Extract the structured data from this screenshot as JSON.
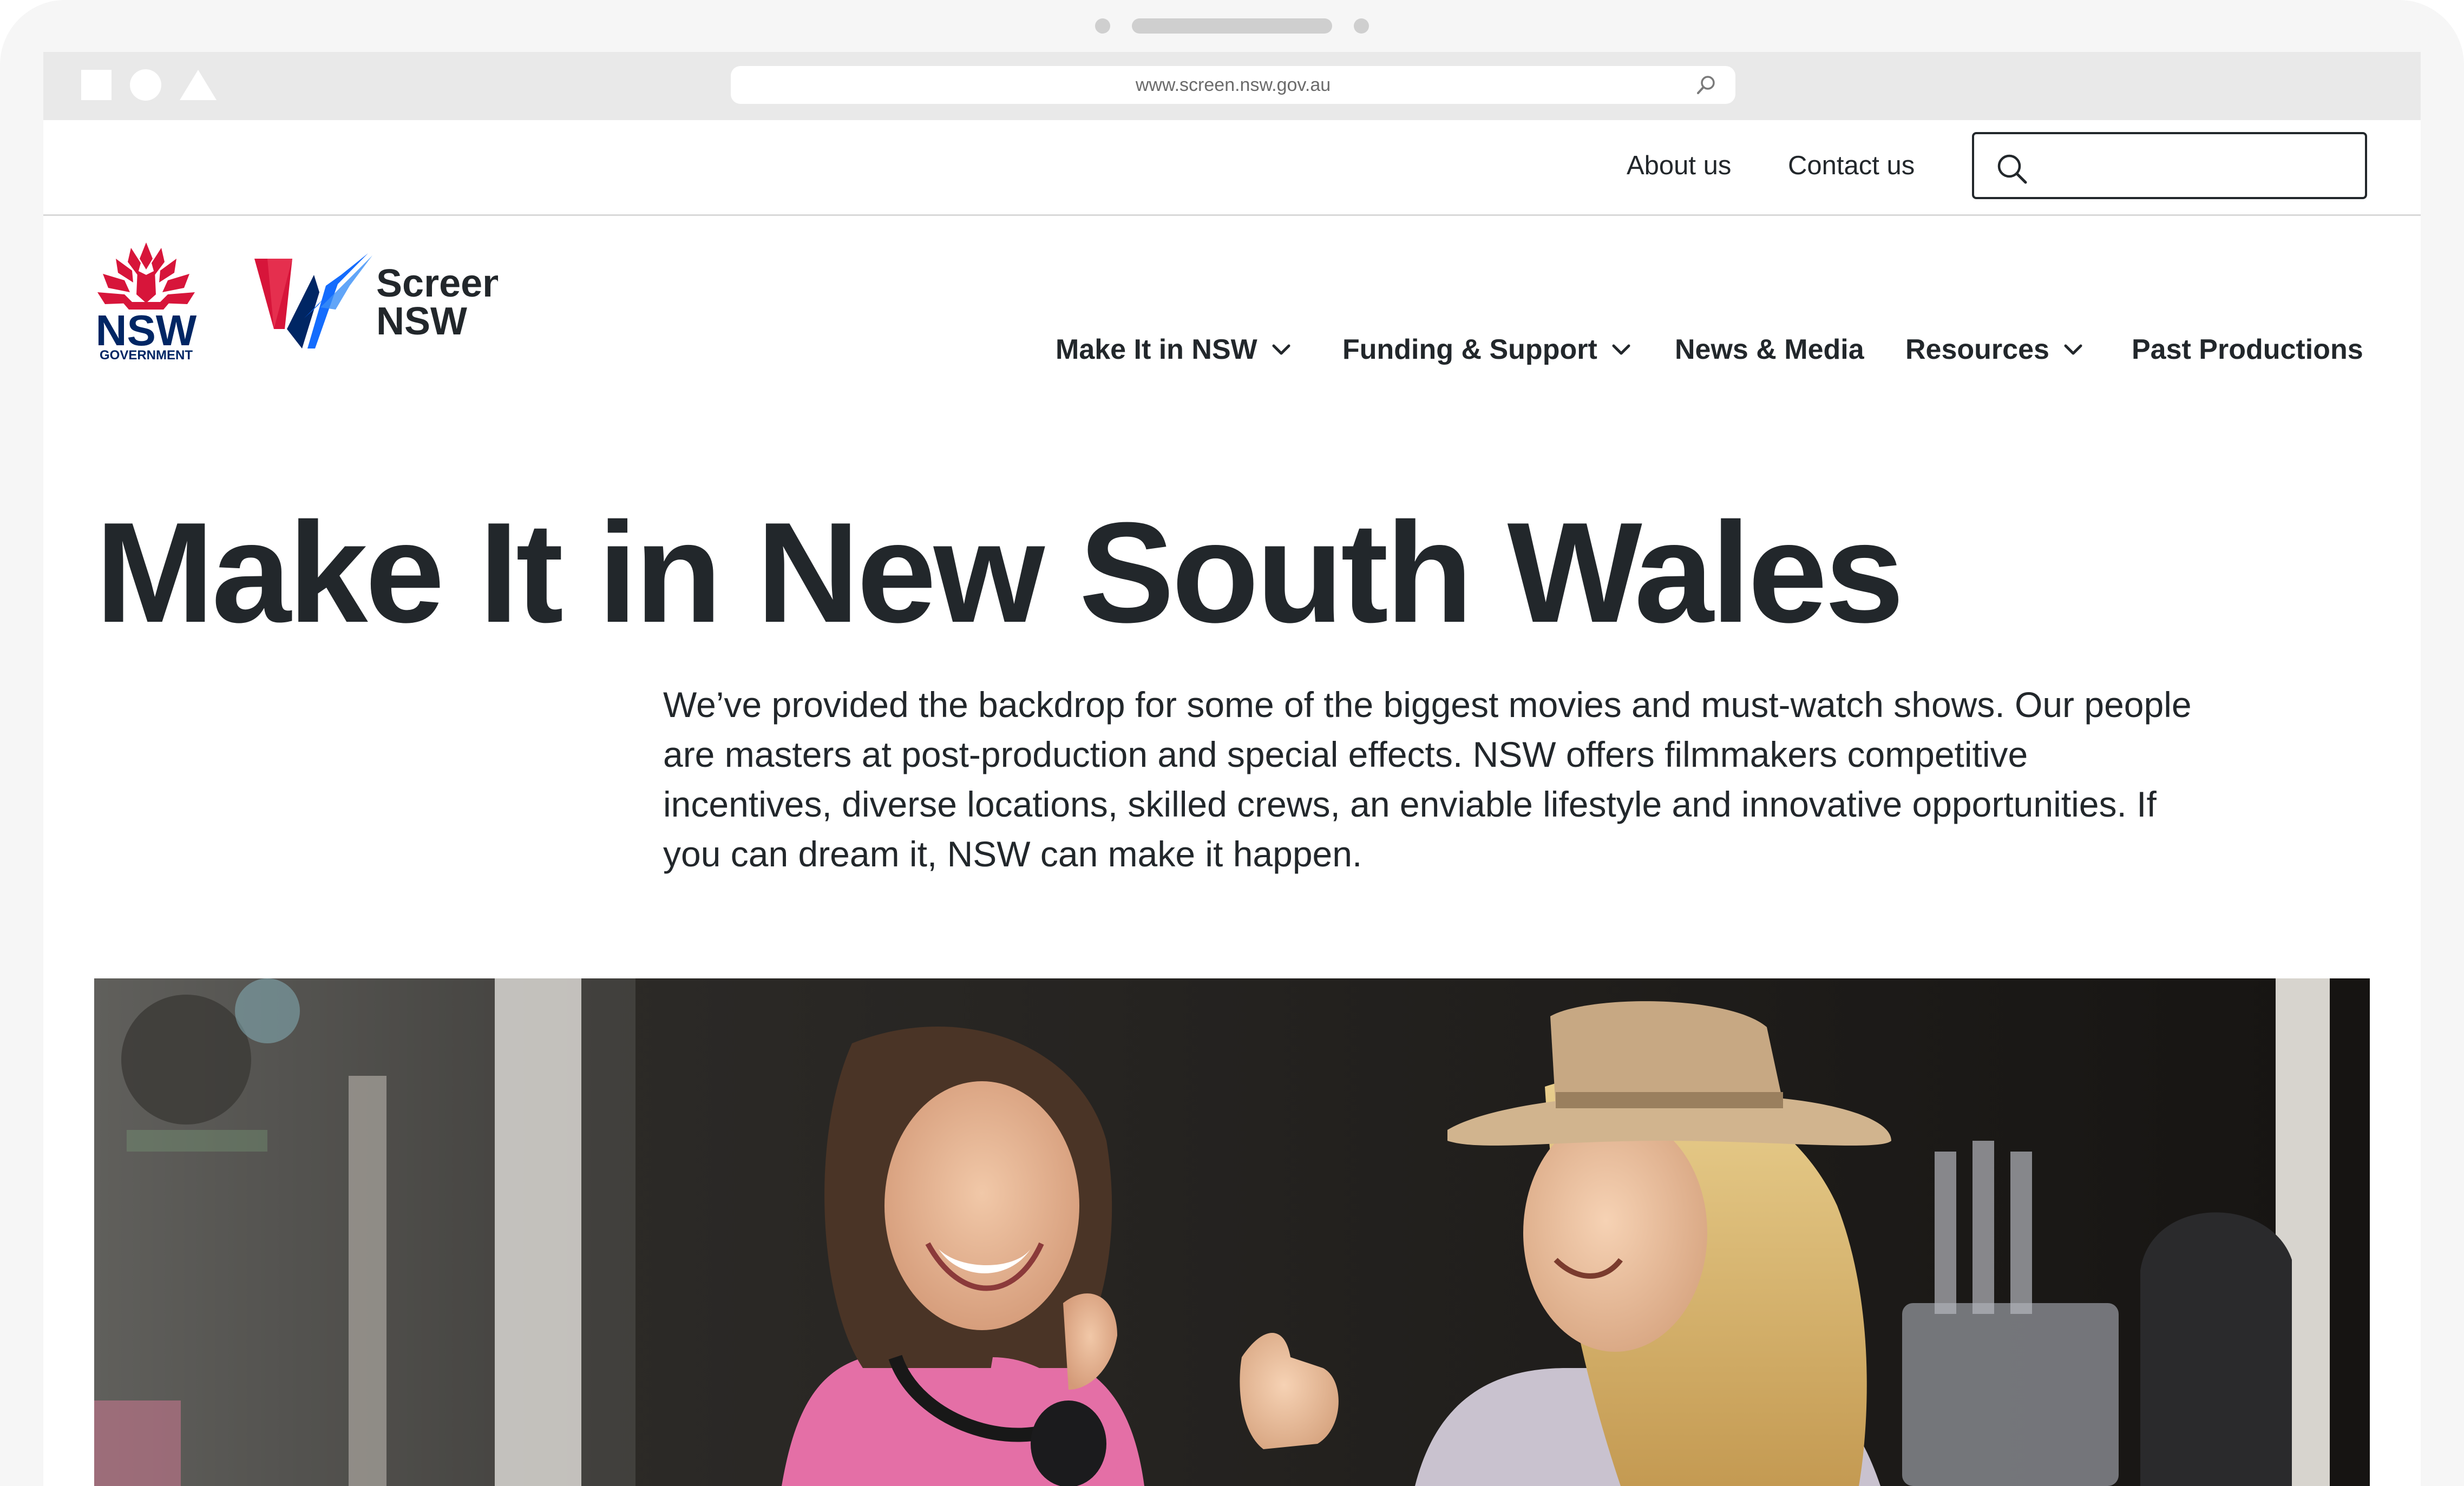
{
  "browser": {
    "url": "www.screen.nsw.gov.au"
  },
  "utility_nav": {
    "about": "About us",
    "contact": "Contact us",
    "search_placeholder": ""
  },
  "logos": {
    "nsw_text": "NSW",
    "nsw_sub": "GOVERNMENT",
    "screen_line1": "Screen",
    "screen_line2": "NSW"
  },
  "main_nav": {
    "items": [
      {
        "label": "Make It in NSW",
        "has_dropdown": true
      },
      {
        "label": "Funding & Support",
        "has_dropdown": true
      },
      {
        "label": "News & Media",
        "has_dropdown": false
      },
      {
        "label": "Resources",
        "has_dropdown": true
      },
      {
        "label": "Past Productions",
        "has_dropdown": false
      }
    ]
  },
  "hero": {
    "title": "Make It in New South Wales",
    "intro": "We’ve provided the backdrop for some of the biggest movies and must-watch shows. Our people are masters at post-production and special effects. NSW offers filmmakers competitive incentives, diverse locations, skilled crews, an enviable lifestyle and innovative opportunities. If you can dream it, NSW can make it happen."
  },
  "colors": {
    "text": "#22272b",
    "nsw_red": "#d7153a",
    "nsw_navy": "#002664",
    "screen_blue": "#146cfd"
  }
}
